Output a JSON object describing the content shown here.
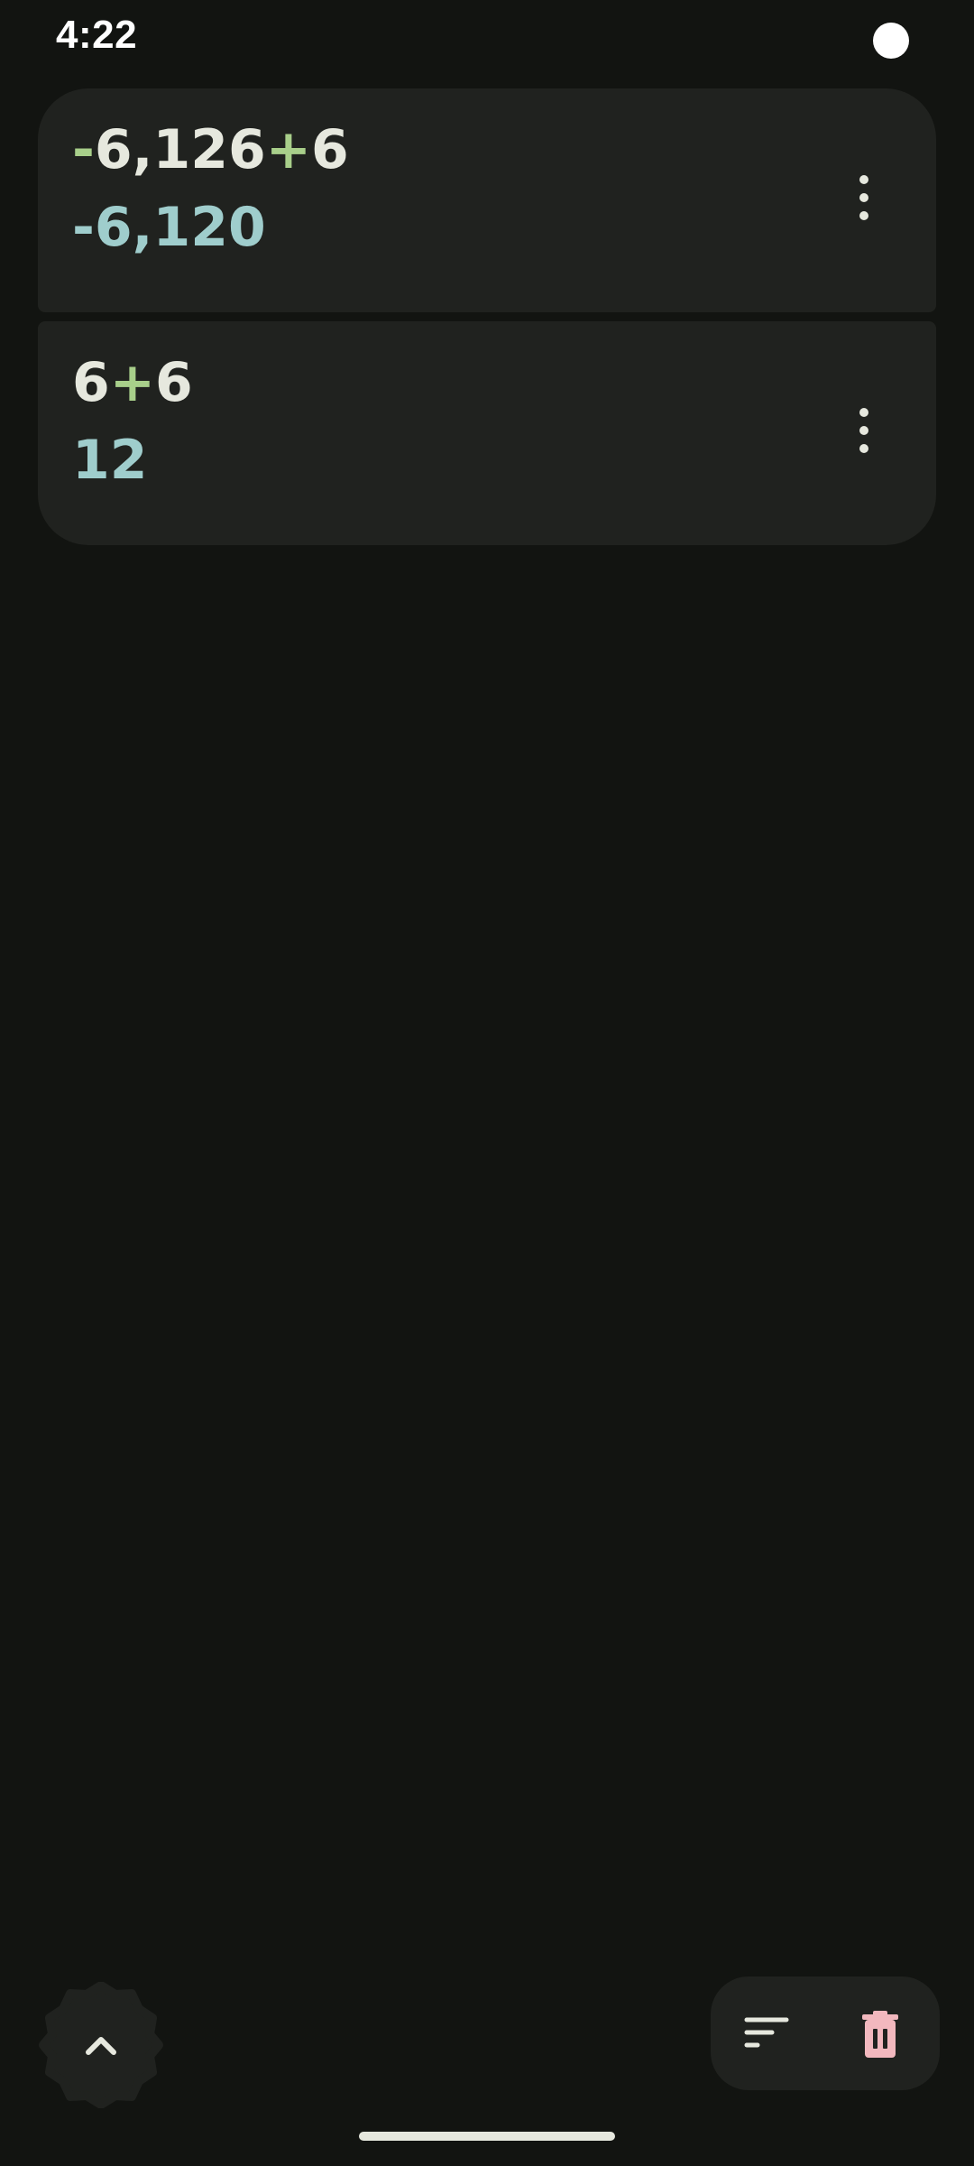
{
  "status_bar": {
    "time": "4:22"
  },
  "history": [
    {
      "expression": {
        "operand_a": "-6,126",
        "operator": "+",
        "operand_b": "6"
      },
      "result": "-6,120",
      "menu_icon": "more-vert-icon"
    },
    {
      "expression": {
        "operand_a": "6",
        "operator": "+",
        "operand_b": "6"
      },
      "result": "12",
      "menu_icon": "more-vert-icon"
    }
  ],
  "controls": {
    "collapse_icon": "chevron-up-icon",
    "sort_icon": "sort-icon",
    "delete_icon": "trash-icon"
  },
  "colors": {
    "background": "#121411",
    "card": "#20221f",
    "text_primary": "#e6e8de",
    "operator_accent": "#a8cf8a",
    "result_accent": "#9fcdcc",
    "delete_accent": "#f2b8be"
  }
}
